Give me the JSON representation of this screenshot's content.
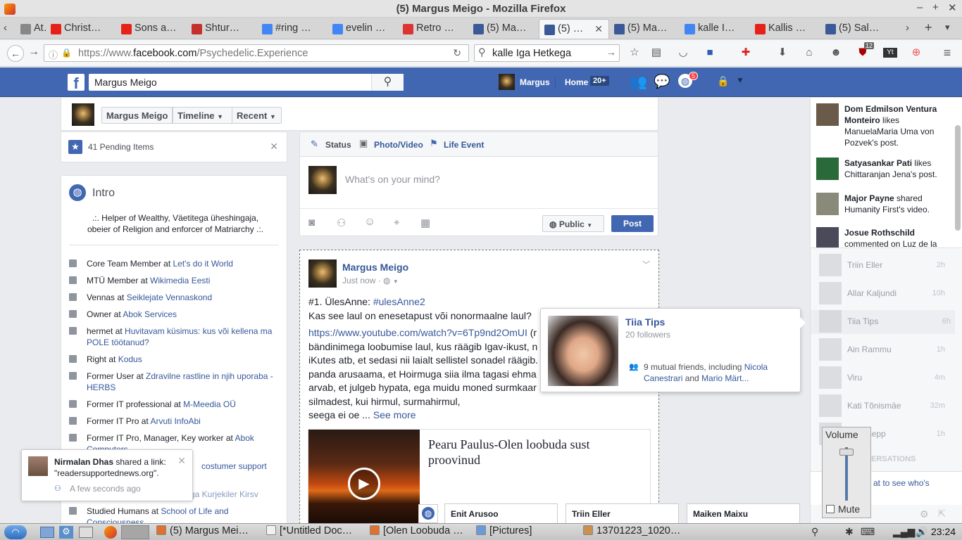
{
  "window": {
    "title": "(5) Margus Meigo - Mozilla Firefox"
  },
  "tabs": [
    {
      "label": "At…",
      "color": "#888"
    },
    {
      "label": "Christ…",
      "color": "#e62117"
    },
    {
      "label": "Sons a…",
      "color": "#e62117"
    },
    {
      "label": "Shtur…",
      "color": "#c4302b"
    },
    {
      "label": "#ring …",
      "color": "#4285f4"
    },
    {
      "label": "evelin …",
      "color": "#4285f4"
    },
    {
      "label": "Retro …",
      "color": "#d33"
    },
    {
      "label": "(5) Ma…",
      "color": "#3b5998"
    },
    {
      "label": "(5) …",
      "color": "#3b5998"
    },
    {
      "label": "(5) Ma…",
      "color": "#3b5998"
    },
    {
      "label": "kalle I…",
      "color": "#4285f4"
    },
    {
      "label": "Kallis …",
      "color": "#e62117"
    },
    {
      "label": "(5) Sal…",
      "color": "#3b5998"
    }
  ],
  "nav": {
    "url_prefix": "https://www.",
    "url_domain": "facebook.com",
    "url_path": "/Psychedelic.Experience",
    "search_value": "kalle Iga Hetkega",
    "ublock_badge": "12"
  },
  "fb": {
    "search_value": "Margus Meigo",
    "profile_name": "Margus",
    "home_label": "Home",
    "home_badge": "20+",
    "notif_badge": "5"
  },
  "timeline_nav": {
    "name": "Margus Meigo",
    "timeline": "Timeline",
    "recent": "Recent"
  },
  "pending": {
    "label": "41 Pending Items"
  },
  "intro": {
    "title": "Intro",
    "bio": ".:. Helper of Wealthy, Väetitega üheshingaja, obeier of Religion and enforcer of Matriarchy .:.",
    "items": [
      {
        "pre": "Core Team Member at ",
        "link": "Let's do it World"
      },
      {
        "pre": "MTÜ Member at ",
        "link": "Wikimedia Eesti"
      },
      {
        "pre": "Vennas at ",
        "link": "Seiklejate Vennaskond"
      },
      {
        "pre": "Owner at ",
        "link": "Abok Services"
      },
      {
        "pre": "hermet at ",
        "link": "Huvitavam küsimus: kus või kellena ma POLE töötanud?"
      },
      {
        "pre": "Right at ",
        "link": "Kodus"
      },
      {
        "pre": "Former User at ",
        "link": "Zdravilne rastline in njih uporaba - HERBS"
      },
      {
        "pre": "Former IT professional at ",
        "link": "M-Meedia OÜ"
      },
      {
        "pre": "Former IT Pro at ",
        "link": "Arvuti InfoAbi"
      },
      {
        "pre": "Former IT Pro, Manager, Key worker at ",
        "link": "Abok Computers"
      },
      {
        "pre": "",
        "link": "costumer support"
      },
      {
        "pre": "",
        "link": "Olga Kurjekiler Kirsv"
      },
      {
        "pre": "Studied Humans at ",
        "link": "School of Life and Consciousness"
      }
    ]
  },
  "composer": {
    "status": "Status",
    "photo_video": "Photo/Video",
    "life_event": "Life Event",
    "placeholder": "What's on your mind?",
    "privacy": "Public",
    "post_button": "Post"
  },
  "post": {
    "author": "Margus Meigo",
    "time": "Just now · ",
    "line1_pre": "#1. ÜlesAnne: ",
    "hashtag": "#ulesAnne2",
    "line2": "Kas see laul on enesetapust või nonormaalne laul?",
    "link": "https://www.youtube.com/watch?v=6Tp9nd2OmUI",
    "link_suffix": " (r",
    "lines": [
      "bändinimega loobumise laul, kus räägib Igav-ikust, n",
      "iKutes atb, et sedasi nii laialt sellistel sonadel räägib.",
      "panda arusaama, et Hoirmuga siia ilma tagasi ehma",
      "arvab, et julgeb hypata, ega muidu moned surmkaar",
      "silmadest, kui hirmul, surmahirmul,"
    ],
    "last_line": "seega ei oe ... ",
    "see_more": "See more",
    "attachment_title": "Pearu Paulus-Olen loobuda sust proovinud"
  },
  "hovercard": {
    "name": "Tiia Tips",
    "followers": "20 followers",
    "mutual_pre": "9 mutual friends, including ",
    "mutual_link1": "Nicola Canestrari",
    "mutual_and": " and ",
    "mutual_link2": "Mario Märt..."
  },
  "ticker": [
    {
      "name": "Dom Edmilson Ventura Monteiro",
      "action": " likes ",
      "rest": "ManuelaMaria Uma von Pozvek's post."
    },
    {
      "name": "Satyasankar Pati",
      "action": " likes ",
      "rest": "Chittaranjan Jena's post."
    },
    {
      "name": "Major Payne",
      "action": " shared ",
      "rest": "Humanity First's video."
    },
    {
      "name": "Josue Rothschild",
      "action": " ",
      "rest": "commented on Luz de la"
    }
  ],
  "chat": [
    {
      "name": "Triin Eller",
      "time": "2h"
    },
    {
      "name": "Allar Kaljundi",
      "time": "10h"
    },
    {
      "name": "Tiia Tips",
      "time": "6h"
    },
    {
      "name": "Ain Rammu",
      "time": "1h"
    },
    {
      "name": "Viru",
      "time": "4m"
    },
    {
      "name": "Kati Tõnismäe",
      "time": "32m"
    },
    {
      "name": "Raudsepp",
      "time": "1h"
    }
  ],
  "chat_misc": {
    "conversations": "ERSATIONS",
    "see_who": "at to see who's"
  },
  "volume": {
    "label": "Volume",
    "mute": "Mute"
  },
  "notification": {
    "name": "Nirmalan Dhas",
    "text": " shared a link: \"readersupportednews.org\".",
    "time": "A few seconds ago"
  },
  "chat_tabs": [
    "Enit Arusoo",
    "Triin Eller",
    "Maiken Maixu"
  ],
  "taskbar": {
    "items": [
      "(5) Margus Mei…",
      "[*Untitled Doc…",
      "[Olen Loobuda …",
      "[Pictures]",
      "13701223_1020…"
    ],
    "clock": "23:24"
  }
}
